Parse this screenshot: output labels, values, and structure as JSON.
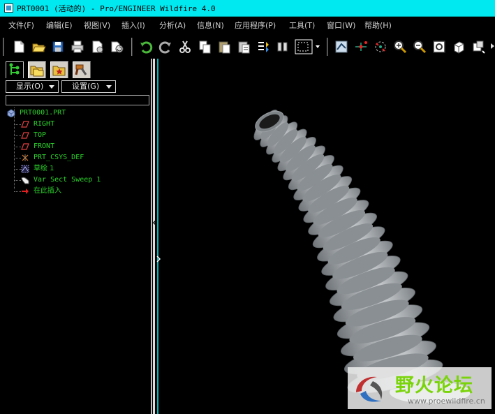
{
  "window": {
    "title": "PRT0001 (活动的) - Pro/ENGINEER Wildfire 4.0"
  },
  "menu": [
    {
      "label": "文件(F)"
    },
    {
      "label": "编辑(E)"
    },
    {
      "label": "视图(V)"
    },
    {
      "label": "插入(I)"
    },
    {
      "label": "分析(A)"
    },
    {
      "label": "信息(N)"
    },
    {
      "label": "应用程序(P)"
    },
    {
      "label": "工具(T)"
    },
    {
      "label": "窗口(W)"
    },
    {
      "label": "帮助(H)"
    }
  ],
  "toolbar": {
    "icons": [
      "new-file-icon",
      "open-folder-icon",
      "save-icon",
      "print-icon",
      "email-icon",
      "redraw-icon",
      "undo-icon",
      "redo-icon",
      "cut-icon",
      "copy-icon",
      "paste-icon",
      "paste-special-icon",
      "regenerate-icon",
      "model-tree-icon",
      "select-box-icon",
      "repaint-icon",
      "datum-axis-icon",
      "spin-center-icon",
      "zoom-in-icon",
      "zoom-out-icon",
      "refit-icon",
      "orient-icon",
      "saved-views-icon"
    ]
  },
  "model_tree": {
    "show_label": "显示(O)",
    "settings_label": "设置(G)",
    "filter_value": "",
    "nodes": [
      {
        "label": "PRT0001.PRT",
        "icon": "part-icon"
      },
      {
        "label": "RIGHT",
        "icon": "datum-plane-icon"
      },
      {
        "label": "TOP",
        "icon": "datum-plane-icon"
      },
      {
        "label": "FRONT",
        "icon": "datum-plane-icon"
      },
      {
        "label": "PRT_CSYS_DEF",
        "icon": "csys-icon"
      },
      {
        "label": "草绘 1",
        "icon": "sketch-icon"
      },
      {
        "label": "Var Sect Sweep 1",
        "icon": "sweep-icon"
      },
      {
        "label": "在此插入",
        "icon": "insert-here-arrow-icon"
      }
    ]
  },
  "watermark": {
    "name": "野火论坛",
    "url": "www.proewildfire.cn"
  },
  "colors": {
    "title_bar": "#00e8f0",
    "tree_text": "#2bd42b",
    "insert_arrow": "#e02020",
    "model_surface": "#b8bcbf"
  }
}
